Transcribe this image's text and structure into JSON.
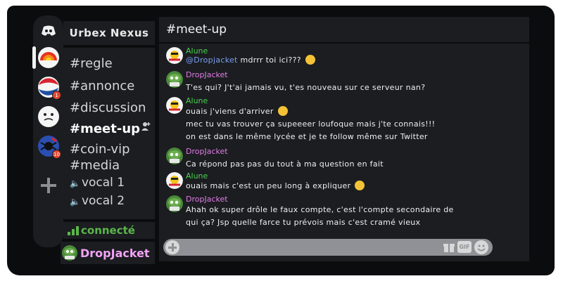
{
  "server": {
    "name": "Urbex Nexus"
  },
  "rail": {
    "servers": [
      {
        "icon": "discord-icon",
        "badge": ""
      },
      {
        "icon": "rainbow-server-icon",
        "badge": "",
        "active": true
      },
      {
        "icon": "pepsi-server-icon",
        "badge": "1"
      },
      {
        "icon": "meme-face-server-icon",
        "badge": ""
      },
      {
        "icon": "spider-server-icon",
        "badge": "10"
      }
    ]
  },
  "channels": {
    "text": [
      "#regle",
      "#annonce",
      "#discussion",
      "#meet-up",
      "#coin-vip",
      "#media"
    ],
    "active": "#meet-up",
    "voice": [
      "vocal 1",
      "vocal 2"
    ]
  },
  "status": {
    "label": "connecté"
  },
  "user": {
    "name": "DropJacket"
  },
  "chat": {
    "channel_title": "#meet-up",
    "messages": [
      {
        "author": "Alune",
        "lines": [
          "@Dropjacket mdrrr toi ici???"
        ],
        "mention": "@Dropjacket",
        "text_after_mention": " mdrrr toi ici???"
      },
      {
        "author": "DropJacket",
        "lines": [
          "T'es qui? J't'ai jamais vu, t'es nouveau sur ce serveur nan?"
        ]
      },
      {
        "author": "Alune",
        "lines": [
          "ouais j'viens d'arriver",
          "mec tu vas trouver ça supeeeer loufoque mais j'te connais!!!",
          "on est dans le même lycée et je te follow même sur Twitter"
        ]
      },
      {
        "author": "DropJacket",
        "lines": [
          "Ca répond pas pas du tout à ma question en fait"
        ]
      },
      {
        "author": "Alune",
        "lines": [
          "ouais mais c'est un peu long à expliquer"
        ]
      },
      {
        "author": "DropJacket",
        "lines": [
          "Ahah ok super drôle le faux compte, c'est l'compte secondaire de",
          "qui ça? Jsp quelle farce tu prévois mais c'est cramé vieux"
        ]
      }
    ]
  },
  "input": {
    "placeholder": "",
    "gif_label": "GIF"
  },
  "colors": {
    "background": "#1b1d21",
    "frame": "#0b0c0e",
    "alune": "#48d24a",
    "dropjacket": "#e27be6",
    "connected": "#5bb64a",
    "user_name": "#f2a2f5"
  }
}
